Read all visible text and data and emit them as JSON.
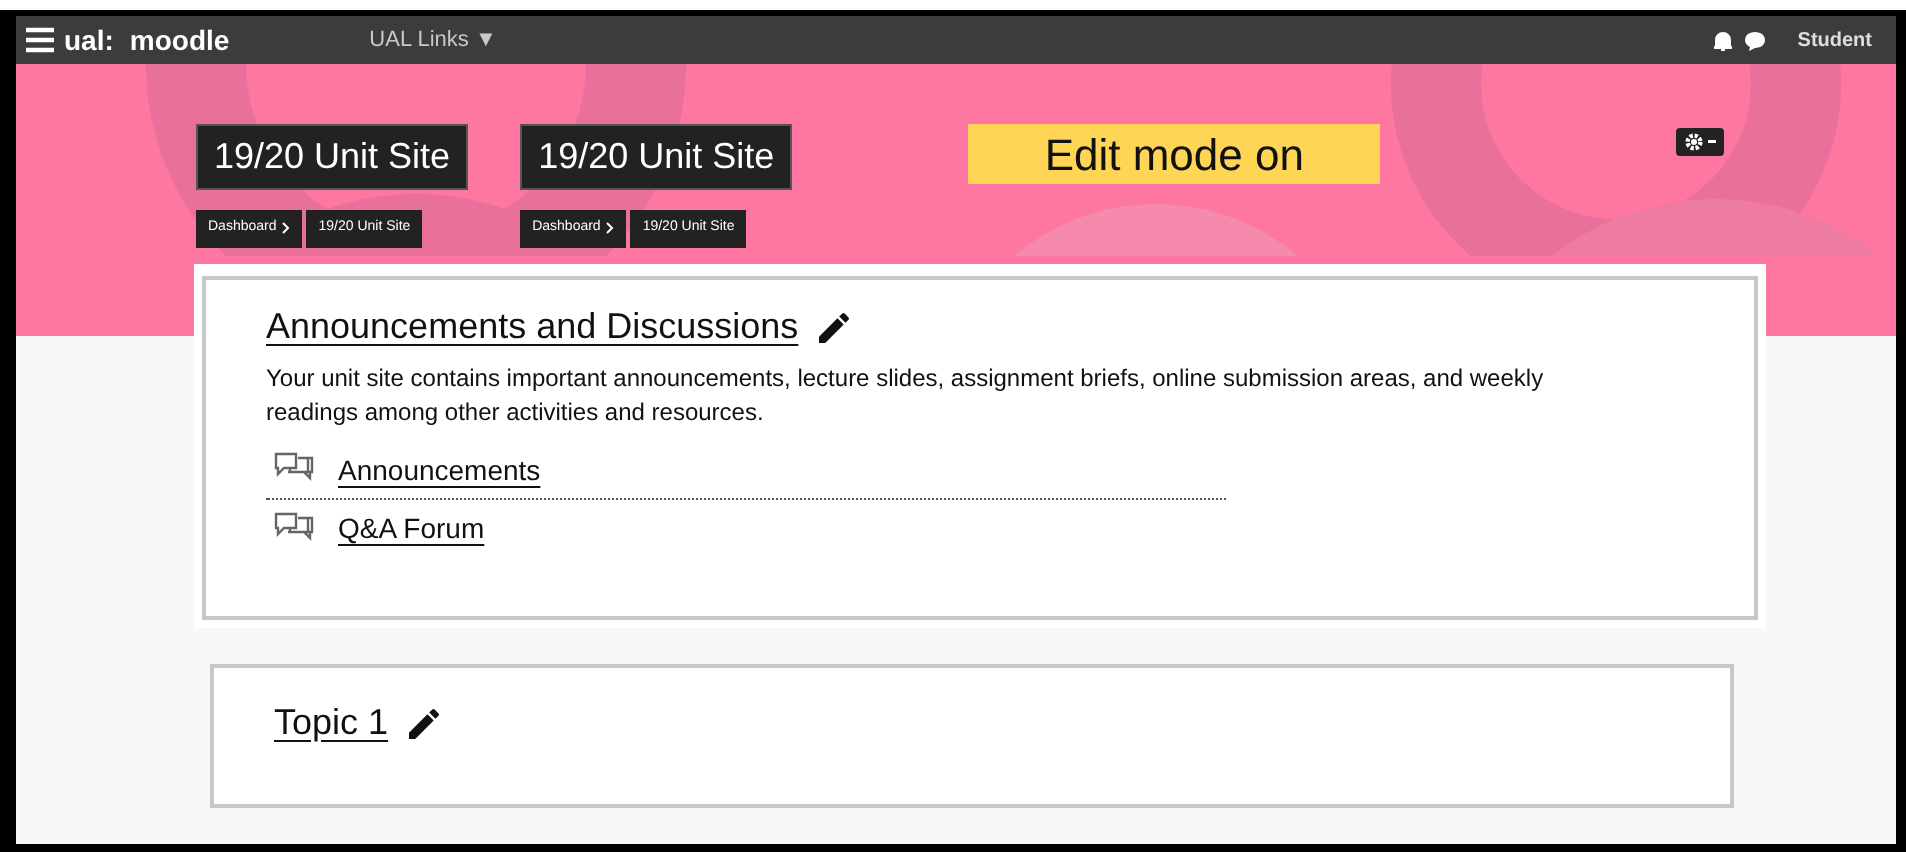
{
  "navbar": {
    "brand_prefix": "ual:",
    "brand": "moodle",
    "menu": "UAL Links ▼",
    "user": "Student"
  },
  "page_headers": [
    {
      "title": "19/20 Unit Site",
      "breadcrumbs": [
        "Dashboard",
        "19/20 Unit Site"
      ]
    },
    {
      "title": "19/20 Unit Site",
      "breadcrumbs": [
        "Dashboard",
        "19/20 Unit Site"
      ]
    }
  ],
  "edit_mode_banner": "Edit mode on",
  "sections": [
    {
      "title": "Announcements and Discussions",
      "description": "Your unit site contains important announcements, lecture slides, assignment briefs, online submission areas, and weekly readings among other activities and resources.",
      "activities": [
        {
          "label": "Announcements"
        },
        {
          "label": "Q&A Forum"
        }
      ]
    },
    {
      "title": "Topic 1"
    }
  ]
}
